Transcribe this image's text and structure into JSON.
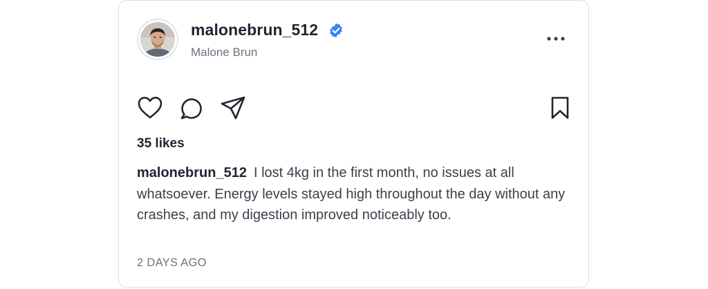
{
  "post": {
    "username": "malonebrun_512",
    "display_name": "Malone Brun",
    "verified": true,
    "likes_text": "35 likes",
    "caption_username": "malonebrun_512",
    "caption_text": "I lost 4kg in the first month, no issues at all whatsoever. Energy levels stayed high throughout the day without any crashes, and my digestion improved noticeably too.",
    "timestamp": "2 DAYS AGO"
  },
  "icons": {
    "verified": "verified-badge-icon",
    "more": "more-options-icon",
    "like": "heart-icon",
    "comment": "comment-icon",
    "share": "send-icon",
    "save": "bookmark-icon"
  },
  "colors": {
    "verified_blue": "#3b82f6",
    "text_primary": "#1f2530",
    "text_secondary": "#6b7280"
  }
}
